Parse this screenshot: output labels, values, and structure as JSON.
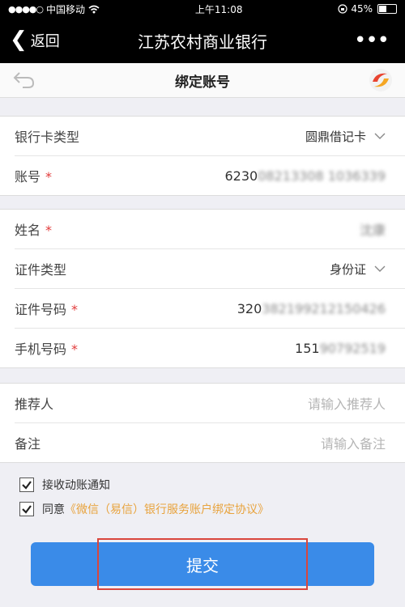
{
  "status_bar": {
    "carrier": "中国移动",
    "time": "上午11:08",
    "battery": "45%",
    "battery_level": 0.45
  },
  "nav": {
    "back_label": "返回",
    "app_title": "江苏农村商业银行",
    "more_label": "•••"
  },
  "page": {
    "title": "绑定账号"
  },
  "card_group": {
    "card_type_label": "银行卡类型",
    "card_type_value": "圆鼎借记卡",
    "account_label": "账号",
    "account_prefix": "6230",
    "account_masked": "08213308 1036339"
  },
  "personal_group": {
    "name_label": "姓名",
    "name_value": "沈康",
    "id_type_label": "证件类型",
    "id_type_value": "身份证",
    "id_number_label": "证件号码",
    "id_number_prefix": "320",
    "id_number_masked": "382199212150426",
    "phone_label": "手机号码",
    "phone_prefix": "151",
    "phone_masked": "90792519"
  },
  "optional_group": {
    "referrer_label": "推荐人",
    "referrer_placeholder": "请输入推荐人",
    "remark_label": "备注",
    "remark_placeholder": "请输入备注"
  },
  "checks": {
    "notify_label": "接收动账通知",
    "agree_prefix": "同意",
    "agreement_link": "《微信（易信）银行服务账户绑定协议》"
  },
  "submit_label": "提交",
  "required_mark": "*",
  "colors": {
    "accent": "#3a8be8",
    "required": "#e23b3b",
    "link": "#e8a33d",
    "highlight": "#d9463c"
  }
}
